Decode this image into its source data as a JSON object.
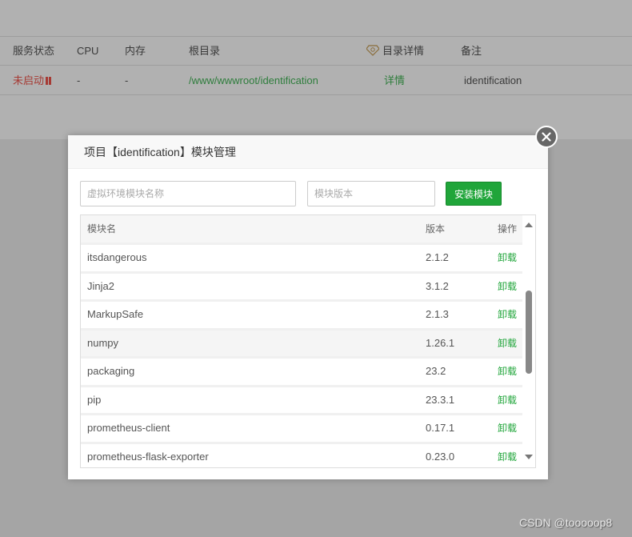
{
  "background_table": {
    "headers": {
      "status": "服务状态",
      "cpu": "CPU",
      "memory": "内存",
      "root": "根目录",
      "detail": "目录详情",
      "note": "备注"
    },
    "row": {
      "status": "未启动",
      "cpu": "-",
      "memory": "-",
      "root": "/www/wwwroot/identification",
      "detail": "详情",
      "note": "identification"
    }
  },
  "modal": {
    "title": "项目【identification】模块管理",
    "close_icon": "close-icon",
    "module_name_placeholder": "虚拟环境模块名称",
    "module_version_placeholder": "模块版本",
    "install_label": "安装模块",
    "table": {
      "headers": {
        "name": "模块名",
        "version": "版本",
        "action": "操作"
      },
      "rows": [
        {
          "name": "itsdangerous",
          "version": "2.1.2",
          "action": "卸载"
        },
        {
          "name": "Jinja2",
          "version": "3.1.2",
          "action": "卸载"
        },
        {
          "name": "MarkupSafe",
          "version": "2.1.3",
          "action": "卸载"
        },
        {
          "name": "numpy",
          "version": "1.26.1",
          "action": "卸载"
        },
        {
          "name": "packaging",
          "version": "23.2",
          "action": "卸载"
        },
        {
          "name": "pip",
          "version": "23.3.1",
          "action": "卸载"
        },
        {
          "name": "prometheus-client",
          "version": "0.17.1",
          "action": "卸载"
        },
        {
          "name": "prometheus-flask-exporter",
          "version": "0.23.0",
          "action": "卸载"
        }
      ]
    }
  },
  "colors": {
    "accent_green": "#20a53a",
    "status_red": "#a63a34"
  },
  "watermark": "CSDN @tooooop8"
}
